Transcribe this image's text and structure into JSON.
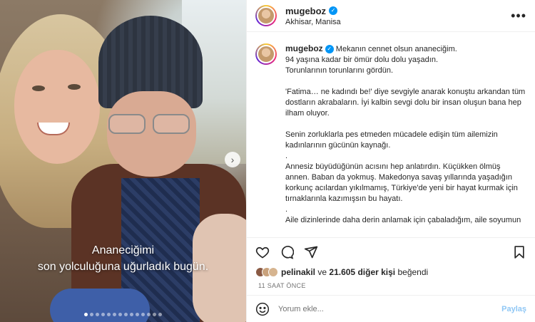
{
  "account": {
    "username": "mugeboz",
    "location": "Akhisar, Manisa"
  },
  "media": {
    "overlay_lines": [
      "Ananeciğimi",
      "son yolculuğuna uğurladık bugün."
    ]
  },
  "caption": {
    "username": "mugeboz",
    "lines": [
      "Mekanın cennet olsun ananeciğim.",
      "94 yaşına kadar bir ömür dolu dolu yaşadın.",
      "Torunlarının torunlarını gördün.",
      "",
      "'Fatima… ne kadındı be!' diye sevgiyle anarak konuştu arkandan tüm",
      "dostların akrabaların. İyi kalbin sevgi dolu bir insan oluşun bana hep",
      "ilham oluyor.",
      "",
      "Senin zorluklarla pes etmeden mücadele edişin tüm ailemizin",
      "kadınlarının gücünün kaynağı.",
      ".",
      "Annesiz büyüdüğünün acısını hep anlatırdın. Küçükken ölmüş",
      "annen. Baban da yokmuş. Makedonya savaş yıllarında yaşadığın",
      "korkunç acılardan yıkılmamış, Türkiye'de yeni bir hayat kurmak için",
      "tırnaklarınla kazımışsın bu hayatı.",
      ".",
      "Aile dizinlerinde daha derin anlamak için çabaladığım, aile soyumun"
    ]
  },
  "likes": {
    "user": "pelinakil",
    "connector": "ve",
    "count_text": "21.605 diğer kişi",
    "suffix": "beğendi"
  },
  "timestamp": "11 SAAT ÖNCE",
  "comment_box": {
    "placeholder": "Yorum ekle...",
    "post_label": "Paylaş"
  }
}
